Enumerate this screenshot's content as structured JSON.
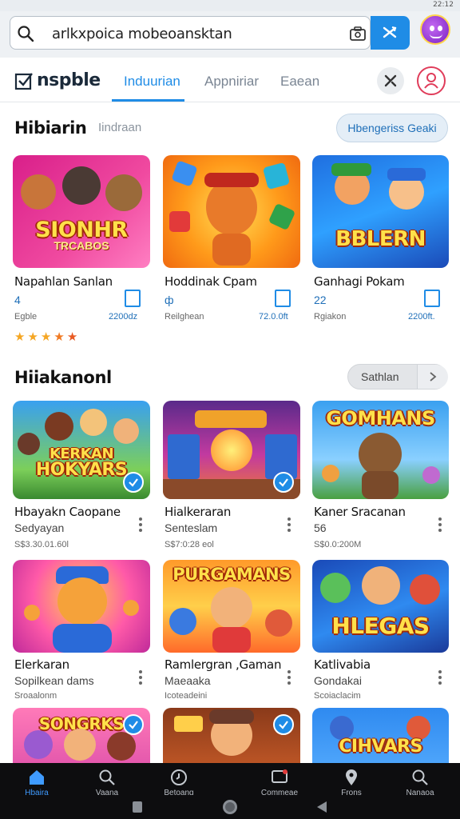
{
  "status": {
    "time": "22:12"
  },
  "search": {
    "query": "arlkxpoica mobeoansktan"
  },
  "nav": {
    "logo": "nspble",
    "tabs": [
      {
        "label": "Induurian",
        "active": true
      },
      {
        "label": "Appniriar",
        "active": false
      },
      {
        "label": "Eaean",
        "active": false
      }
    ]
  },
  "section1": {
    "title": "Hibiarin",
    "subtitle": "Iindraan",
    "action": "Hbengeriss Geaki",
    "cards": [
      {
        "art_title": "SIONHR",
        "art_sub": "TRCABOS",
        "name": "Napahlan Sanlan",
        "meta": "4",
        "small_left": "Egble",
        "small_right": "2200dz"
      },
      {
        "art_title": "",
        "art_sub": "",
        "name": "Hoddinak Cpam",
        "meta": "ф",
        "small_left": "Reilghean",
        "small_right": "72.0.0ft"
      },
      {
        "art_title": "BBLERN",
        "art_sub": "",
        "name": "Ganhagi Pokam",
        "meta": "22",
        "small_left": "Rgiakon",
        "small_right": "2200ft."
      }
    ],
    "rating": 5
  },
  "section2": {
    "title": "Hiiakanonl",
    "action": "Sathlan",
    "rows": [
      [
        {
          "art_title": "KERKAN",
          "art_sub": "HOKYARS",
          "name": "Hbayakn Caopane",
          "meta": "Sedyayan",
          "small": "S$3.30.01.60l",
          "checked": true
        },
        {
          "art_title": "",
          "art_sub": "",
          "name": "Hialkeraran",
          "meta": "Senteslam",
          "small": "S$7:0:28 eol",
          "checked": true
        },
        {
          "art_title": "GOMHANS",
          "art_sub": "",
          "name": "Kaner Sracanan",
          "meta": "56",
          "small": "S$0.0:200M",
          "checked": false
        }
      ],
      [
        {
          "art_title": "",
          "art_sub": "",
          "name": "Elerkaran",
          "meta": "Sopilkean dams",
          "small": "Sroaalonm",
          "checked": false
        },
        {
          "art_title": "PURGAMANS",
          "art_sub": "",
          "name": "Ramlergran ,Gaman",
          "meta": "Maeaaka",
          "small": "Icoteadeini",
          "checked": false
        },
        {
          "art_title": "HLEGAS",
          "art_sub": "",
          "name": "Katlivabia",
          "meta": "Gondakai",
          "small": "Scoiaclacim",
          "checked": false
        }
      ],
      [
        {
          "art_title": "SONGRKS",
          "art_sub": "",
          "checked": true
        },
        {
          "art_title": "",
          "art_sub": "",
          "checked": true
        },
        {
          "art_title": "CIHVARS",
          "art_sub": "",
          "checked": false
        }
      ]
    ]
  },
  "bottom_nav": [
    {
      "label": "Hbaira",
      "icon": "home-icon",
      "active": true
    },
    {
      "label": "Vaana",
      "icon": "search-icon",
      "active": false
    },
    {
      "label": "Betoang",
      "icon": "clock-icon",
      "active": false
    },
    {
      "label": "Commeae",
      "icon": "chat-icon",
      "active": false
    },
    {
      "label": "Frons",
      "icon": "location-icon",
      "active": false
    },
    {
      "label": "Nanaoa",
      "icon": "search-icon",
      "active": false
    }
  ],
  "colors": {
    "accent": "#1f8ce6",
    "star": "#f5a623"
  }
}
